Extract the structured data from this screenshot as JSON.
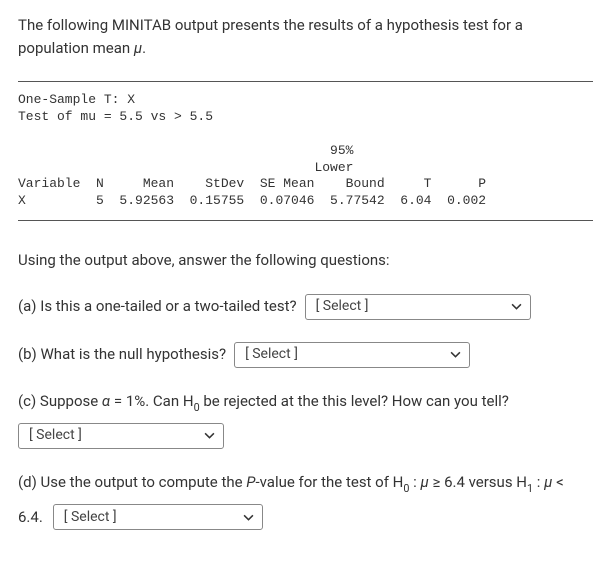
{
  "intro": {
    "text_before_mu": "The following MINITAB output presents the results of a hypothesis test for a population mean ",
    "mu": "μ",
    "text_after_mu": "."
  },
  "minitab": {
    "line1": "One-Sample T: X",
    "line2": "Test of mu = 5.5 vs > 5.5",
    "hdr1": "                                        95%",
    "hdr2": "                                      Lower",
    "hdr3": "Variable  N     Mean    StDev  SE Mean    Bound     T      P",
    "row": "X         5  5.92563  0.15755  0.07046  5.77542  6.04  0.002"
  },
  "using": "Using the output above, answer the following questions:",
  "qa": {
    "label": "(a)  Is this a one-tailed or a two-tailed test?",
    "select": "[ Select ]"
  },
  "qb": {
    "label": "(b)  What is the null hypothesis?",
    "select": "[ Select ]"
  },
  "qc": {
    "before": "(c)  Suppose ",
    "alpha": "α",
    "mid": " = 1%.  Can H",
    "sub0": "0",
    "after": " be rejected at the this level? How can you tell?",
    "select": "[ Select ]"
  },
  "qd": {
    "line1_before": "(d)  Use the output to compute the ",
    "pval": "P",
    "line1_mid1": "-value for the test of H",
    "sub0": "0",
    "colon1": " : ",
    "mu1": "μ",
    "geq": " ≥ 6.4 versus H",
    "sub1": "1",
    "colon2": " : ",
    "mu2": "μ",
    "lt": " <",
    "line2_val": "6.4.",
    "select": "[ Select ]"
  }
}
